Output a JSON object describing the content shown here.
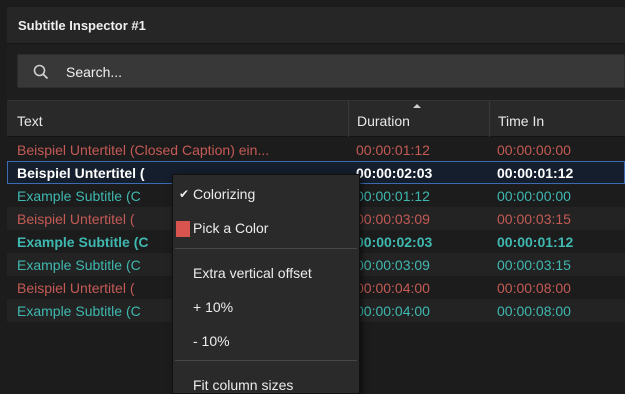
{
  "window": {
    "title": "Subtitle Inspector #1"
  },
  "search": {
    "placeholder": "Search...",
    "icon": "search-icon"
  },
  "columns": {
    "text": "Text",
    "duration": "Duration",
    "time_in": "Time In"
  },
  "colors": {
    "red": "#c45a55",
    "teal": "#3fb8b0",
    "selection": "#3d6bb0",
    "swatch": "#d9534f"
  },
  "rows": [
    {
      "text": "Beispiel Untertitel (Closed Caption) ein...",
      "duration": "00:00:01:12",
      "time_in": "00:00:00:00",
      "color": "red"
    },
    {
      "text": "Beispiel Untertitel (",
      "duration": "00:00:02:03",
      "time_in": "00:00:01:12",
      "color": "white",
      "bold": true,
      "selected": true
    },
    {
      "text": "Example Subtitle (C",
      "duration": "00:00:01:12",
      "time_in": "00:00:00:00",
      "color": "teal"
    },
    {
      "text": "Beispiel Untertitel (",
      "duration": "00:00:03:09",
      "time_in": "00:00:03:15",
      "color": "red"
    },
    {
      "text": "Example Subtitle (C",
      "duration": "00:00:02:03",
      "time_in": "00:00:01:12",
      "color": "teal",
      "bold": true
    },
    {
      "text": "Example Subtitle (C",
      "duration": "00:00:03:09",
      "time_in": "00:00:03:15",
      "color": "teal"
    },
    {
      "text": "Beispiel Untertitel (",
      "duration": "00:00:04:00",
      "time_in": "00:00:08:00",
      "color": "red"
    },
    {
      "text": "Example Subtitle (C",
      "duration": "00:00:04:00",
      "time_in": "00:00:08:00",
      "color": "teal"
    }
  ],
  "context_menu": {
    "colorizing": "Colorizing",
    "colorizing_checked": true,
    "pick_color": "Pick a Color",
    "extra_offset": "Extra vertical offset",
    "plus": "+ 10%",
    "minus": "- 10%",
    "fit_columns": "Fit column sizes"
  }
}
